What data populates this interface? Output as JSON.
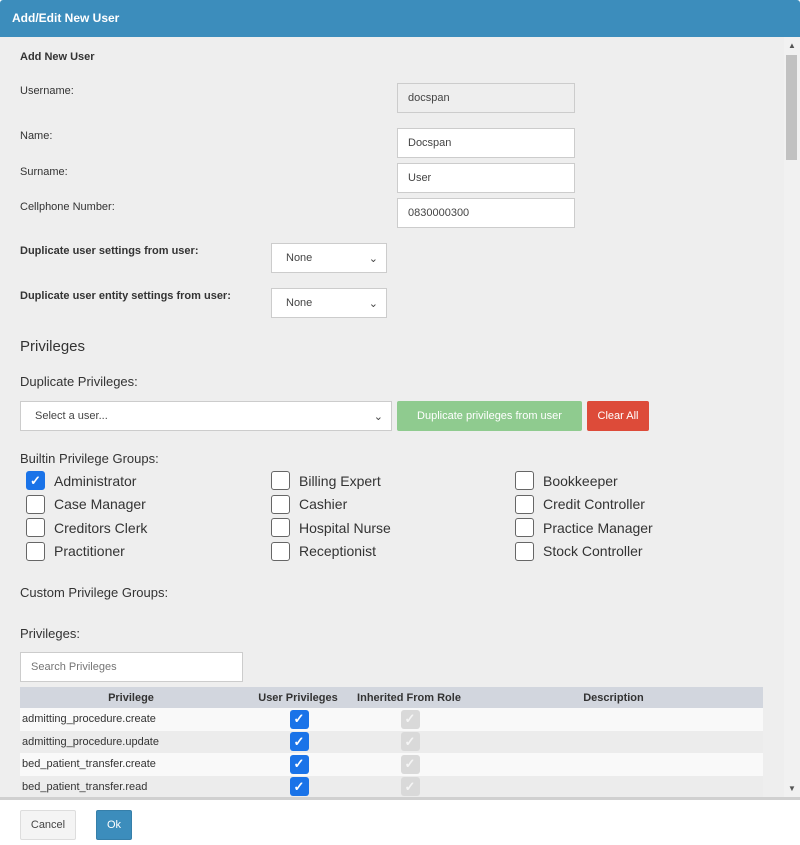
{
  "title": "Add/Edit New User",
  "section_title": "Add New User",
  "fields": {
    "username": {
      "label": "Username:",
      "value": "docspan"
    },
    "name": {
      "label": "Name:",
      "value": "Docspan"
    },
    "surname": {
      "label": "Surname:",
      "value": "User"
    },
    "cellphone": {
      "label": "Cellphone Number:",
      "value": "0830000300"
    },
    "dup_settings": {
      "label": "Duplicate user settings from user:",
      "value": "None"
    },
    "dup_entity": {
      "label": "Duplicate user entity settings from user:",
      "value": "None"
    }
  },
  "privileges_heading": "Privileges",
  "duplicate_privileges": {
    "label": "Duplicate Privileges:",
    "placeholder": "Select a user...",
    "dup_button": "Duplicate privileges from user",
    "clear_button": "Clear All"
  },
  "builtin_label": "Builtin Privilege Groups:",
  "groups": [
    {
      "label": "Administrator",
      "checked": true
    },
    {
      "label": "Billing Expert",
      "checked": false
    },
    {
      "label": "Bookkeeper",
      "checked": false
    },
    {
      "label": "Case Manager",
      "checked": false
    },
    {
      "label": "Cashier",
      "checked": false
    },
    {
      "label": "Credit Controller",
      "checked": false
    },
    {
      "label": "Creditors Clerk",
      "checked": false
    },
    {
      "label": "Hospital Nurse",
      "checked": false
    },
    {
      "label": "Practice Manager",
      "checked": false
    },
    {
      "label": "Practitioner",
      "checked": false
    },
    {
      "label": "Receptionist",
      "checked": false
    },
    {
      "label": "Stock Controller",
      "checked": false
    }
  ],
  "custom_label": "Custom Privilege Groups:",
  "privileges_label": "Privileges:",
  "search_placeholder": "Search Privileges",
  "table": {
    "headers": [
      "Privilege",
      "User Privileges",
      "Inherited From Role",
      "Description"
    ],
    "rows": [
      {
        "privilege": "admitting_procedure.create",
        "user": true,
        "inherited": true,
        "description": ""
      },
      {
        "privilege": "admitting_procedure.update",
        "user": true,
        "inherited": true,
        "description": ""
      },
      {
        "privilege": "bed_patient_transfer.create",
        "user": true,
        "inherited": true,
        "description": ""
      },
      {
        "privilege": "bed_patient_transfer.read",
        "user": true,
        "inherited": true,
        "description": ""
      }
    ]
  },
  "footer": {
    "cancel": "Cancel",
    "ok": "Ok"
  }
}
